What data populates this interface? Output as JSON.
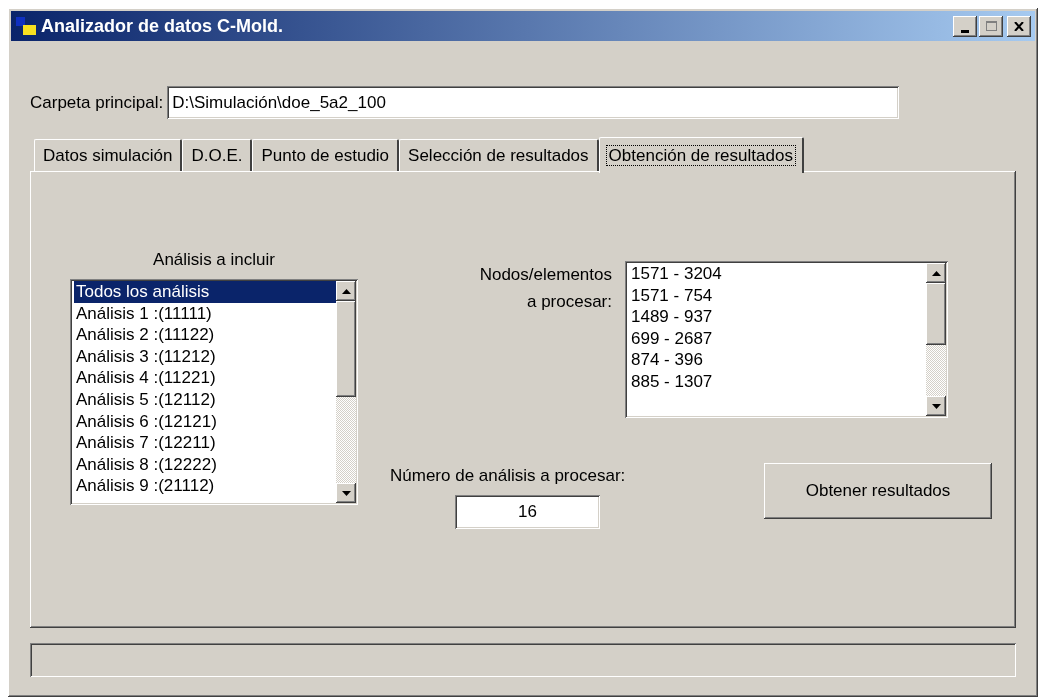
{
  "window": {
    "title": "Analizador de datos C-Mold."
  },
  "main_folder": {
    "label": "Carpeta principal:",
    "value": "D:\\Simulación\\doe_5a2_100"
  },
  "tabs": [
    {
      "label": "Datos simulación",
      "selected": false
    },
    {
      "label": "D.O.E.",
      "selected": false
    },
    {
      "label": "Punto de estudio",
      "selected": false
    },
    {
      "label": "Selección de resultados",
      "selected": false
    },
    {
      "label": "Obtención de resultados",
      "selected": true
    }
  ],
  "analyses": {
    "label": "Análisis a incluir",
    "items": [
      {
        "text": "Todos los análisis",
        "selected": true
      },
      {
        "text": "Análisis 1 :(11111)",
        "selected": false
      },
      {
        "text": "Análisis 2 :(11122)",
        "selected": false
      },
      {
        "text": "Análisis 3 :(11212)",
        "selected": false
      },
      {
        "text": "Análisis 4 :(11221)",
        "selected": false
      },
      {
        "text": "Análisis 5 :(12112)",
        "selected": false
      },
      {
        "text": "Análisis 6 :(12121)",
        "selected": false
      },
      {
        "text": "Análisis 7 :(12211)",
        "selected": false
      },
      {
        "text": "Análisis 8 :(12222)",
        "selected": false
      },
      {
        "text": "Análisis 9 :(21112)",
        "selected": false
      }
    ]
  },
  "nodes": {
    "label_lines": [
      "Nodos/elementos",
      "a procesar:"
    ],
    "items": [
      {
        "text": "1571 - 3204",
        "selected": false
      },
      {
        "text": "1571 - 754",
        "selected": false
      },
      {
        "text": "1489 - 937",
        "selected": false
      },
      {
        "text": "699 - 2687",
        "selected": false
      },
      {
        "text": "874 - 396",
        "selected": false
      },
      {
        "text": "885 - 1307",
        "selected": false
      }
    ]
  },
  "analysis_count": {
    "label": "Número de análisis a procesar:",
    "value": "16"
  },
  "button": {
    "label": "Obtener resultados"
  }
}
